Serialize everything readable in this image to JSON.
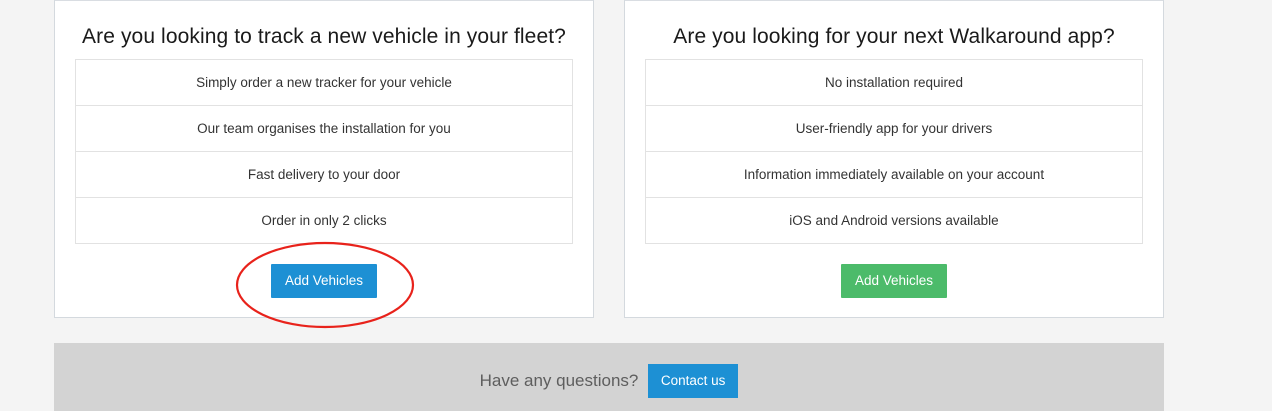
{
  "cards": [
    {
      "title": "Are you looking to track a new vehicle in your fleet?",
      "features": [
        "Simply order a new tracker for your vehicle",
        "Our team organises the installation for you",
        "Fast delivery to your door",
        "Order in only 2 clicks"
      ],
      "button_label": "Add Vehicles",
      "button_color": "#1d90d4"
    },
    {
      "title": "Are you looking for your next Walkaround app?",
      "features": [
        "No installation required",
        "User-friendly app for your drivers",
        "Information immediately available on your account",
        "iOS and Android versions available"
      ],
      "button_label": "Add Vehicles",
      "button_color": "#4cbb6a"
    }
  ],
  "annotation": {
    "shape": "ellipse",
    "color": "#e8221b",
    "highlights": "cards.0.button_label"
  },
  "footer": {
    "question": "Have any questions?",
    "contact_label": "Contact us"
  }
}
